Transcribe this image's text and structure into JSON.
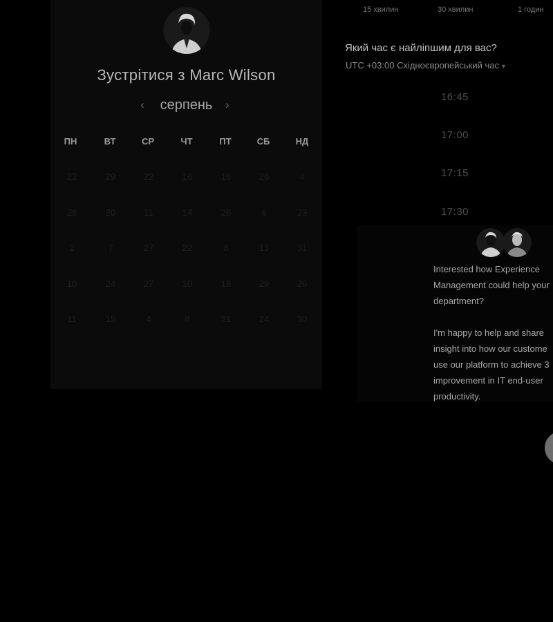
{
  "durations": [
    "15 хвилин",
    "30 хвилин",
    "1 годин"
  ],
  "booking": {
    "title": "Зустрітися з Marc Wilson",
    "month": "серпень",
    "prev_icon": "‹",
    "next_icon": "›",
    "weekdays": [
      "ПН",
      "ВТ",
      "СР",
      "ЧТ",
      "ПТ",
      "СБ",
      "НД"
    ],
    "weeks": [
      [
        "22",
        "29",
        "22",
        "16",
        "16",
        "26",
        "4"
      ],
      [
        "28",
        "20",
        "11",
        "14",
        "28",
        "6",
        "23"
      ],
      [
        "2",
        "7",
        "27",
        "22",
        "8",
        "13",
        "31"
      ],
      [
        "10",
        "24",
        "27",
        "10",
        "18",
        "29",
        "26"
      ],
      [
        "11",
        "15",
        "4",
        "8",
        "31",
        "24",
        "30"
      ]
    ]
  },
  "schedule": {
    "question": "Який час є найліпшим для вас?",
    "timezone": "UTC +03:00 Східноєвропейський час",
    "caret_icon": "▾",
    "slots": [
      "16:45",
      "17:00",
      "17:15",
      "17:30"
    ]
  },
  "chat": {
    "message_1": "Interested how Experience\nManagement could help your\ndepartment?",
    "message_2": "I'm happy to help and share\ninsight into how our custome\nuse our platform to achieve 3\nimprovement in IT end-user\nproductivity."
  },
  "colors": {
    "background": "#000000",
    "panel": "#0b0b0b",
    "text": "#c4c4c4"
  },
  "icons": [
    "host-avatar",
    "chat-avatar",
    "chevron-left-icon",
    "chevron-right-icon",
    "caret-down-icon",
    "chat-launcher-icon"
  ]
}
